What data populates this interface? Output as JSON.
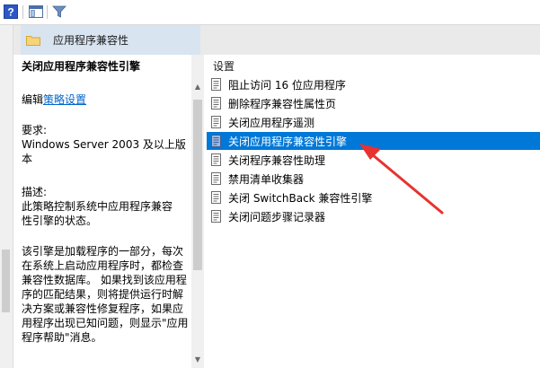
{
  "toolbar": {
    "icons": [
      "help-icon",
      "show-hide-pane-icon",
      "filter-icon"
    ]
  },
  "header": {
    "title": "应用程序兼容性"
  },
  "description": {
    "title": "关闭应用程序兼容性引擎",
    "edit_prefix": "编辑",
    "edit_link": "策略设置",
    "requirements_label": "要求:",
    "requirements_line1": "Windows Server 2003 及以上版",
    "requirements_line2": "本",
    "desc_label": "描述:",
    "desc_line1": "  此策略控制系统中应用程序兼容",
    "desc_line2": "性引擎的状态。",
    "body_line1": "该引擎是加载程序的一部分，每次",
    "body_line2": "在系统上启动应用程序时，都检查",
    "body_line3": "兼容性数据库。 如果找到该应用程",
    "body_line4": "序的匹配结果，则将提供运行时解",
    "body_line5": "决方案或兼容性修复程序，如果应",
    "body_line6": "用程序出现已知问题，则显示\"应用",
    "body_line7": "程序帮助\"消息。"
  },
  "settings": {
    "column_header": "设置",
    "items": [
      {
        "label": "阻止访问 16 位应用程序",
        "selected": false
      },
      {
        "label": "删除程序兼容性属性页",
        "selected": false
      },
      {
        "label": "关闭应用程序遥测",
        "selected": false
      },
      {
        "label": "关闭应用程序兼容性引擎",
        "selected": true
      },
      {
        "label": "关闭程序兼容性助理",
        "selected": false
      },
      {
        "label": "禁用清单收集器",
        "selected": false
      },
      {
        "label": "关闭 SwitchBack 兼容性引擎",
        "selected": false
      },
      {
        "label": "关闭问题步骤记录器",
        "selected": false
      }
    ]
  },
  "colors": {
    "selection": "#0078d7",
    "annotation_arrow": "#e8322f",
    "link": "#0066cc"
  }
}
